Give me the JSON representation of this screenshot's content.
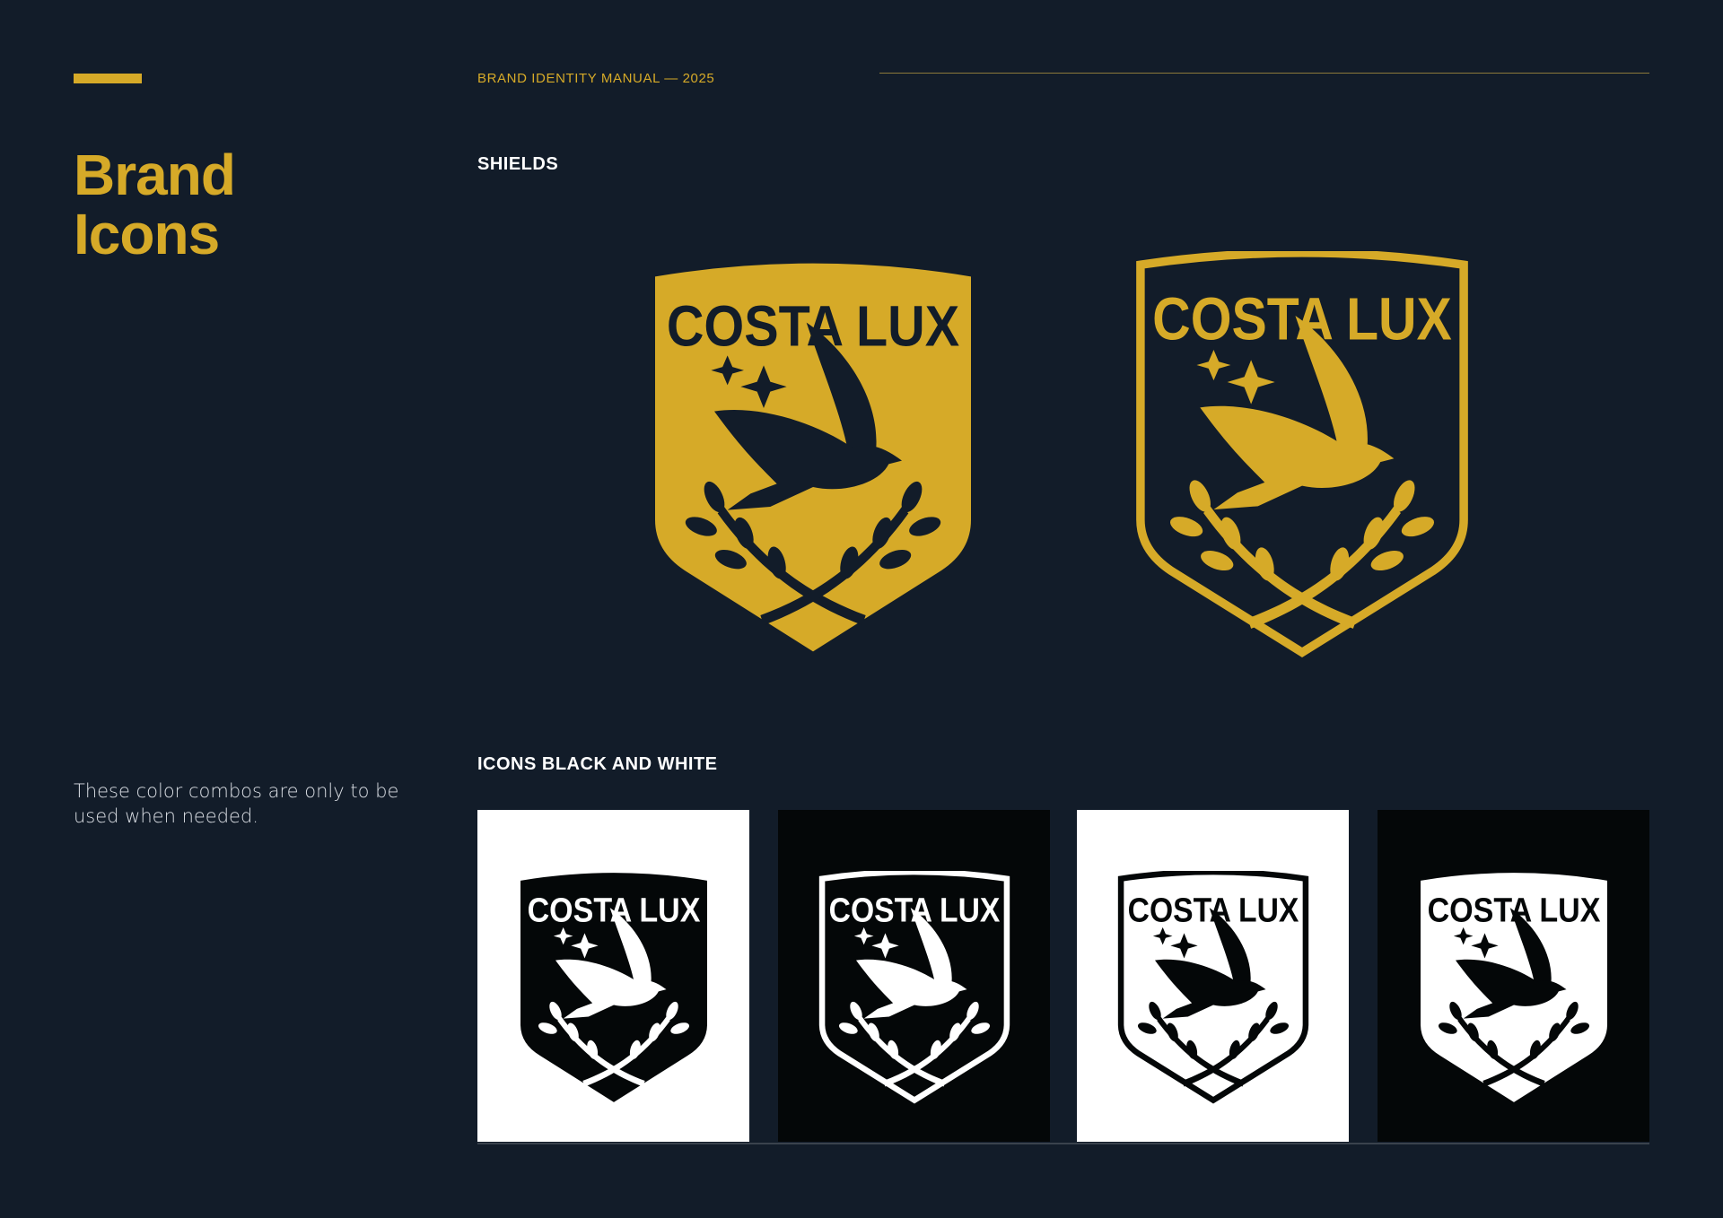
{
  "header": {
    "manual_label": "BRAND IDENTITY MANUAL — 2025"
  },
  "sidebar": {
    "title_line1": "Brand",
    "title_line2": "Icons",
    "note": "These color combos are only to be used when needed."
  },
  "sections": {
    "shields_label": "SHIELDS",
    "icons_label": "ICONS BLACK AND WHITE"
  },
  "logo": {
    "wordmark": "COSTA LUX"
  },
  "colors": {
    "background": "#121c29",
    "gold": "#d6aa28",
    "black": "#040708",
    "white": "#ffffff"
  }
}
